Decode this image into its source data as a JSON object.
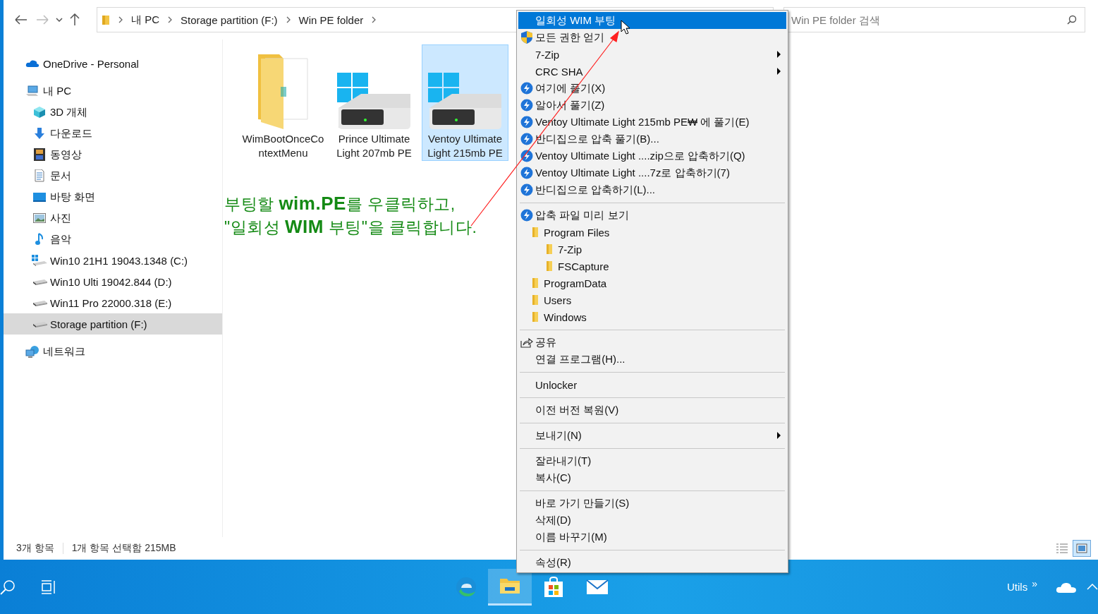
{
  "address_bar": {
    "path": [
      "내 PC",
      "Storage partition (F:)",
      "Win PE folder"
    ]
  },
  "search": {
    "placeholder": "Win PE folder 검색"
  },
  "sidebar": {
    "items": [
      {
        "label": "OneDrive - Personal",
        "kind": "cloud",
        "selected": false
      },
      {
        "label": "내 PC",
        "kind": "pc",
        "selected": false,
        "children": [
          {
            "label": "3D 개체",
            "kind": "cube",
            "selected": false
          },
          {
            "label": "다운로드",
            "kind": "download",
            "selected": false
          },
          {
            "label": "동영상",
            "kind": "film",
            "selected": false
          },
          {
            "label": "문서",
            "kind": "document",
            "selected": false
          },
          {
            "label": "바탕 화면",
            "kind": "desktop",
            "selected": false
          },
          {
            "label": "사진",
            "kind": "picture",
            "selected": false
          },
          {
            "label": "음악",
            "kind": "music",
            "selected": false
          },
          {
            "label": "Win10 21H1 19043.1348 (C:)",
            "kind": "windrive",
            "selected": false
          },
          {
            "label": "Win10 Ulti 19042.844 (D:)",
            "kind": "drive",
            "selected": false
          },
          {
            "label": "Win11 Pro 22000.318 (E:)",
            "kind": "drive",
            "selected": false
          },
          {
            "label": "Storage partition (F:)",
            "kind": "drive",
            "selected": true
          }
        ]
      },
      {
        "label": "네트워크",
        "kind": "network",
        "selected": false
      }
    ]
  },
  "files": [
    {
      "name": "WimBootOnceContextMenu",
      "kind": "folder",
      "selected": false
    },
    {
      "name": "Prince Ultimate Light 207mb PE",
      "kind": "pe-drive",
      "selected": false
    },
    {
      "name": "Ventoy Ultimate Light 215mb PE",
      "kind": "pe-drive",
      "selected": true
    }
  ],
  "annotation": {
    "lines": [
      "부팅할 **wim.PE**를 우클릭하고,",
      "\"일회성 **WIM** 부팅\"을 클릭합니다."
    ]
  },
  "status_bar": {
    "count": "3개 항목",
    "selection": "1개 항목 선택함 215MB"
  },
  "context_menu": {
    "groups": [
      [
        {
          "label": "일회성 WIM 부팅",
          "kind": "plain",
          "submenu": false,
          "selected": true
        },
        {
          "label": "모든 권한 얻기",
          "kind": "shield",
          "submenu": false,
          "selected": false
        },
        {
          "label": "7-Zip",
          "kind": "plain",
          "submenu": true,
          "selected": false
        },
        {
          "label": "CRC SHA",
          "kind": "plain",
          "submenu": true,
          "selected": false
        },
        {
          "label": "여기에 풀기(X)",
          "kind": "bandizip",
          "submenu": false,
          "selected": false
        },
        {
          "label": "알아서 풀기(Z)",
          "kind": "bandizip",
          "submenu": false,
          "selected": false
        },
        {
          "label": "Ventoy Ultimate Light 215mb PE₩ 에 풀기(E)",
          "kind": "bandizip",
          "submenu": false,
          "selected": false
        },
        {
          "label": "반디집으로 압축 풀기(B)...",
          "kind": "bandizip",
          "submenu": false,
          "selected": false
        },
        {
          "label": "Ventoy Ultimate Light ....zip으로 압축하기(Q)",
          "kind": "bandizip",
          "submenu": false,
          "selected": false
        },
        {
          "label": "Ventoy Ultimate Light ....7z로 압축하기(7)",
          "kind": "bandizip",
          "submenu": false,
          "selected": false
        },
        {
          "label": "반디집으로 압축하기(L)...",
          "kind": "bandizip",
          "submenu": false,
          "selected": false
        }
      ],
      [
        {
          "label": "압축 파일 미리 보기",
          "kind": "bandizip",
          "submenu": false,
          "selected": false,
          "children": [
            {
              "label": "Program Files",
              "kind": "folder",
              "submenu": false,
              "selected": false,
              "children": [
                {
                  "label": "7-Zip",
                  "kind": "folder",
                  "submenu": false,
                  "selected": false
                },
                {
                  "label": "FSCapture",
                  "kind": "folder",
                  "submenu": false,
                  "selected": false
                }
              ]
            },
            {
              "label": "ProgramData",
              "kind": "folder",
              "submenu": false,
              "selected": false
            },
            {
              "label": "Users",
              "kind": "folder",
              "submenu": false,
              "selected": false
            },
            {
              "label": "Windows",
              "kind": "folder",
              "submenu": false,
              "selected": false
            }
          ]
        }
      ],
      [
        {
          "label": "공유",
          "kind": "share",
          "submenu": false,
          "selected": false
        },
        {
          "label": "연결 프로그램(H)...",
          "kind": "plain",
          "submenu": false,
          "selected": false
        }
      ],
      [
        {
          "label": "Unlocker",
          "kind": "plain",
          "submenu": false,
          "selected": false
        }
      ],
      [
        {
          "label": "이전 버전 복원(V)",
          "kind": "plain",
          "submenu": false,
          "selected": false
        }
      ],
      [
        {
          "label": "보내기(N)",
          "kind": "plain",
          "submenu": true,
          "selected": false
        }
      ],
      [
        {
          "label": "잘라내기(T)",
          "kind": "plain",
          "submenu": false,
          "selected": false
        },
        {
          "label": "복사(C)",
          "kind": "plain",
          "submenu": false,
          "selected": false
        }
      ],
      [
        {
          "label": "바로 가기 만들기(S)",
          "kind": "plain",
          "submenu": false,
          "selected": false
        },
        {
          "label": "삭제(D)",
          "kind": "plain",
          "submenu": false,
          "selected": false
        },
        {
          "label": "이름 바꾸기(M)",
          "kind": "plain",
          "submenu": false,
          "selected": false
        }
      ],
      [
        {
          "label": "속성(R)",
          "kind": "plain",
          "submenu": false,
          "selected": false
        }
      ]
    ]
  },
  "taskbar": {
    "apps": [
      {
        "kind": "edge",
        "active": false
      },
      {
        "kind": "explorer",
        "active": true
      },
      {
        "kind": "store",
        "active": false
      },
      {
        "kind": "mail",
        "active": false
      }
    ],
    "tray_label": "Utils",
    "overflow": "»"
  }
}
